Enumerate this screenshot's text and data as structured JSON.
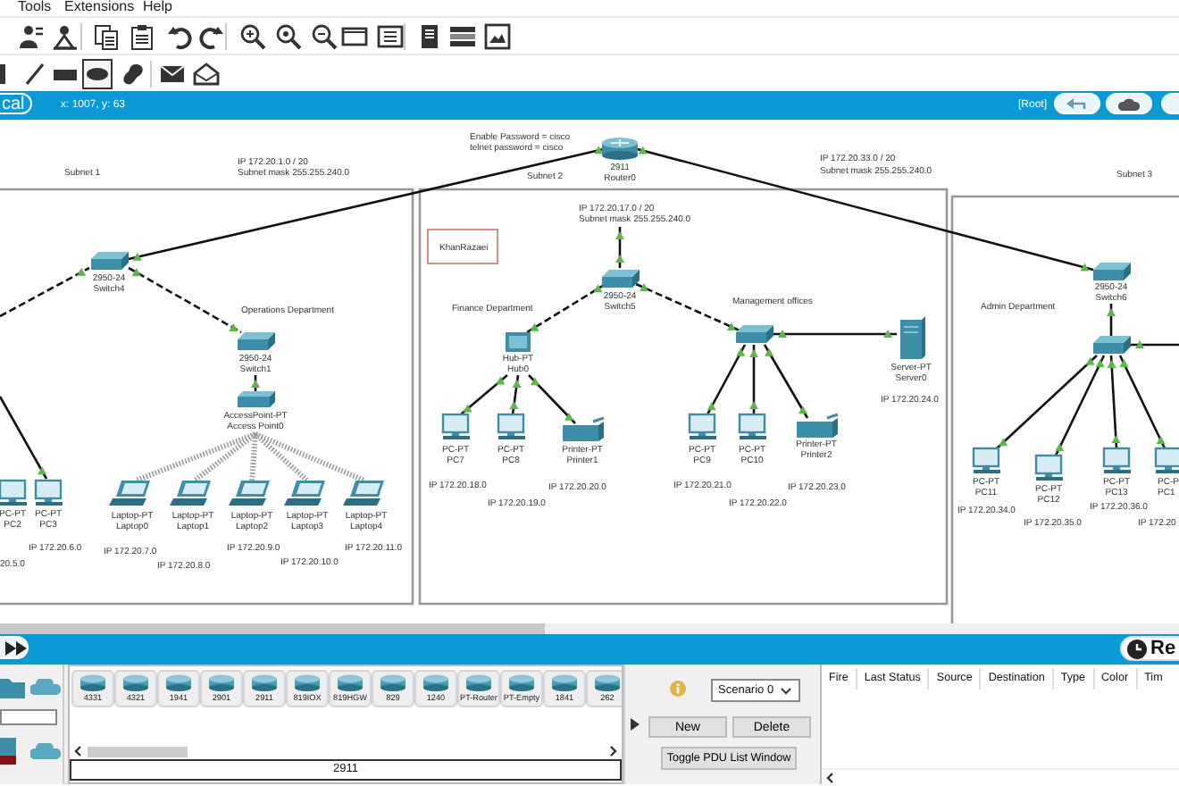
{
  "menu": [
    {
      "label": "Tools"
    },
    {
      "label": "Extensions"
    },
    {
      "label": "Help"
    }
  ],
  "drawing_tools": [
    {
      "kind": "bar",
      "selected": false
    },
    {
      "kind": "line",
      "selected": false
    },
    {
      "kind": "rectangle",
      "selected": false
    },
    {
      "kind": "ellipse",
      "selected": true
    },
    {
      "kind": "freeform",
      "selected": false
    },
    {
      "kind": "envelope",
      "selected": false
    },
    {
      "kind": "open-envelope",
      "selected": false
    }
  ],
  "workspace_bar": {
    "mode": "cal",
    "coordinates": "x: 1007, y: 63",
    "path": "[Root]"
  },
  "canvas": {
    "annotations": [
      {
        "kind": "subnet",
        "text": "Subnet 1"
      },
      {
        "kind": "ip",
        "text": "IP 172.20.1.0 / 20"
      },
      {
        "kind": "ip",
        "text": "Subnet mask 255.255.240.0"
      },
      {
        "kind": "ip",
        "text": "Enable Password = cisco"
      },
      {
        "kind": "ip",
        "text": "telnet password = cisco"
      },
      {
        "kind": "subnet",
        "text": "Subnet 2"
      },
      {
        "kind": "ip",
        "text": "IP 172.20.33.0 / 20"
      },
      {
        "kind": "ip",
        "text": "Subnet mask 255.255.240.0"
      },
      {
        "kind": "subnet",
        "text": "Subnet 3"
      },
      {
        "kind": "ip",
        "text": "IP 172.20.17.0 / 20"
      },
      {
        "kind": "ip",
        "text": "Subnet mask 255.255.240.0"
      },
      {
        "kind": "note",
        "text": "KhanRazaei"
      },
      {
        "kind": "department",
        "text": "Operations Department"
      },
      {
        "kind": "department",
        "text": "Finance Department"
      },
      {
        "kind": "department",
        "text": "Management offices"
      },
      {
        "kind": "department",
        "text": "Admin Department"
      },
      {
        "kind": "ip",
        "text": "IP 172.20.24.0"
      },
      {
        "kind": "ip",
        "text": "IP 172.20.6.0"
      },
      {
        "kind": "ip",
        "text": "20.5.0"
      },
      {
        "kind": "ip",
        "text": "IP 172.20.7.0"
      },
      {
        "kind": "ip",
        "text": "IP 172.20.8.0"
      },
      {
        "kind": "ip",
        "text": "IP 172.20.9.0"
      },
      {
        "kind": "ip",
        "text": "IP 172.20.10.0"
      },
      {
        "kind": "ip",
        "text": "IP 172.20.11.0"
      },
      {
        "kind": "ip",
        "text": "IP 172.20.18.0"
      },
      {
        "kind": "ip",
        "text": "IP 172.20.19.0"
      },
      {
        "kind": "ip",
        "text": "IP 172.20.20.0"
      },
      {
        "kind": "ip",
        "text": "IP 172.20.21.0"
      },
      {
        "kind": "ip",
        "text": "IP 172.20.22.0"
      },
      {
        "kind": "ip",
        "text": "IP 172.20.23.0"
      },
      {
        "kind": "ip",
        "text": "IP 172.20.34.0"
      },
      {
        "kind": "ip",
        "text": "IP 172.20.35.0"
      },
      {
        "kind": "ip",
        "text": "IP 172.20.36.0"
      },
      {
        "kind": "ip",
        "text": "IP 172.20"
      }
    ],
    "devices": [
      {
        "kind": "router",
        "model": "2911",
        "name": "Router0"
      },
      {
        "kind": "switch",
        "model": "2950-24",
        "name": "Switch4"
      },
      {
        "kind": "switch",
        "model": "2950-24",
        "name": "Switch1"
      },
      {
        "kind": "access-point",
        "model": "AccessPoint-PT",
        "name": "Access Point0"
      },
      {
        "kind": "switch",
        "model": "2950-24",
        "name": "Switch5"
      },
      {
        "kind": "hub",
        "model": "Hub-PT",
        "name": "Hub0"
      },
      {
        "kind": "switch"
      },
      {
        "kind": "server",
        "model": "Server-PT",
        "name": "Server0"
      },
      {
        "kind": "switch",
        "model": "2950-24",
        "name": "Switch6"
      },
      {
        "kind": "switch"
      },
      {
        "kind": "pc",
        "model": "PC-PT",
        "name": "PC2"
      },
      {
        "kind": "pc",
        "model": "PC-PT",
        "name": "PC3"
      },
      {
        "kind": "laptop",
        "model": "Laptop-PT",
        "name": "Laptop0"
      },
      {
        "kind": "laptop",
        "model": "Laptop-PT",
        "name": "Laptop1"
      },
      {
        "kind": "laptop",
        "model": "Laptop-PT",
        "name": "Laptop2"
      },
      {
        "kind": "laptop",
        "model": "Laptop-PT",
        "name": "Laptop3"
      },
      {
        "kind": "laptop",
        "model": "Laptop-PT",
        "name": "Laptop4"
      },
      {
        "kind": "pc",
        "model": "PC-PT",
        "name": "PC7"
      },
      {
        "kind": "pc",
        "model": "PC-PT",
        "name": "PC8"
      },
      {
        "kind": "printer",
        "model": "Printer-PT",
        "name": "Printer1"
      },
      {
        "kind": "pc",
        "model": "PC-PT",
        "name": "PC9"
      },
      {
        "kind": "pc",
        "model": "PC-PT",
        "name": "PC10"
      },
      {
        "kind": "printer",
        "model": "Printer-PT",
        "name": "Printer2"
      },
      {
        "kind": "pc",
        "model": "PC-PT",
        "name": "PC11"
      },
      {
        "kind": "pc",
        "model": "PC-PT",
        "name": "PC12"
      },
      {
        "kind": "pc",
        "model": "PC-PT",
        "name": "PC13"
      },
      {
        "kind": "pc",
        "model": "PC-P",
        "name": "PC1"
      }
    ]
  },
  "sim_bar": {
    "mode": "Re"
  },
  "device_panel": {
    "models": [
      "4331",
      "4321",
      "1941",
      "2901",
      "2911",
      "819IOX",
      "819HGW",
      "829",
      "1240",
      "PT-Router",
      "PT-Empty",
      "1841",
      "262"
    ],
    "selected_model": "2911"
  },
  "scenario": {
    "value": "Scenario 0",
    "buttons": [
      "New",
      "Delete"
    ],
    "toggle_label": "Toggle PDU List Window"
  },
  "pdu_table": {
    "columns": [
      "Fire",
      "Last Status",
      "Source",
      "Destination",
      "Type",
      "Color",
      "Tim"
    ]
  }
}
